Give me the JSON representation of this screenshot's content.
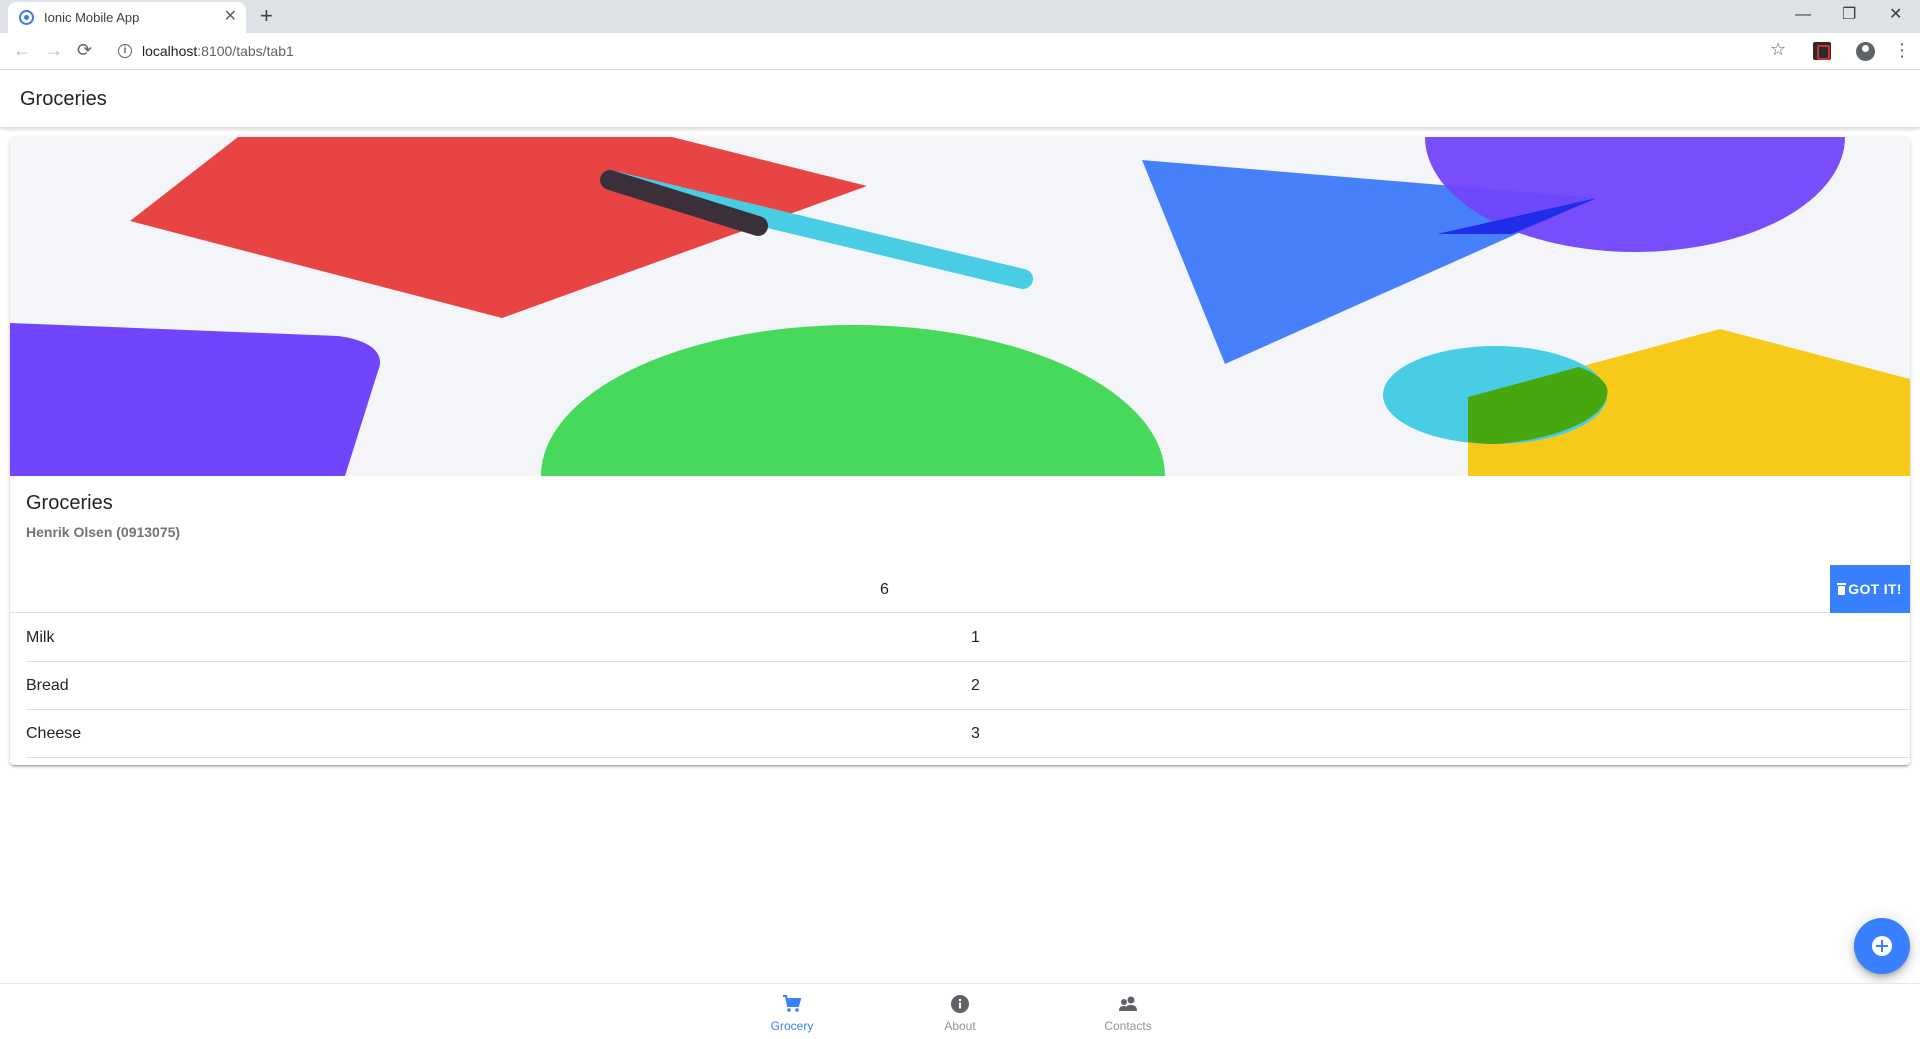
{
  "browser": {
    "tab_title": "Ionic Mobile App",
    "tab_close": "✕",
    "new_tab": "+",
    "url_host": "localhost",
    "url_path": ":8100/tabs/tab1",
    "window": {
      "minimize": "—",
      "restore": "❐",
      "close": "✕"
    },
    "nav": {
      "back": "←",
      "forward": "→",
      "reload": "⟳"
    },
    "star": "☆",
    "menu": "⋮",
    "info": "i"
  },
  "header": {
    "title": "Groceries"
  },
  "card": {
    "title": "Groceries",
    "subtitle": "Henrik Olsen (0913075)",
    "total": "6",
    "got_it_label": "GOT IT!",
    "items": [
      {
        "name": "Milk",
        "quantity": "1"
      },
      {
        "name": "Bread",
        "quantity": "2"
      },
      {
        "name": "Cheese",
        "quantity": "3"
      }
    ]
  },
  "tabs": [
    {
      "label": "Grocery",
      "icon": "cart-icon",
      "selected": true
    },
    {
      "label": "About",
      "icon": "information-icon",
      "selected": false
    },
    {
      "label": "Contacts",
      "icon": "people-icon",
      "selected": false
    }
  ],
  "colors": {
    "primary": "#3880ff",
    "tab_inactive": "#92949c",
    "image_red": "#e84444",
    "image_blue": "#4780fb",
    "image_purple": "#7145fb",
    "image_green": "#46d95c",
    "image_cyan": "#48cde5",
    "image_yellow": "#f7c919"
  }
}
